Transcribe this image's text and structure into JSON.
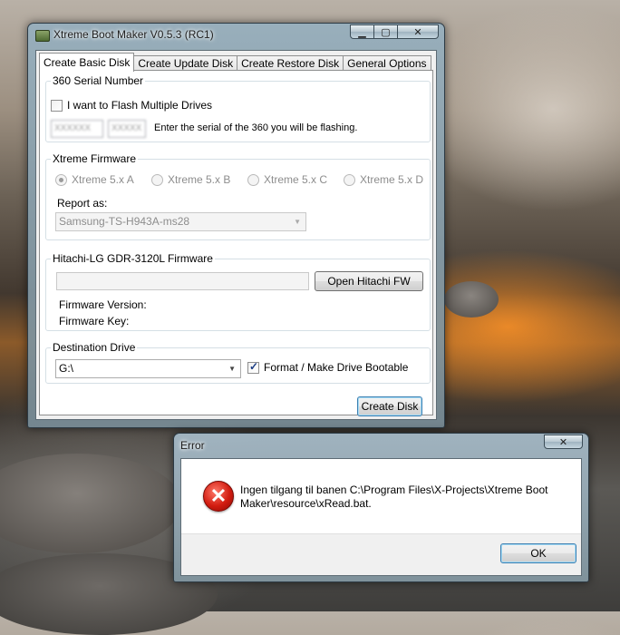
{
  "main_window": {
    "title": "Xtreme Boot Maker V0.5.3 (RC1)",
    "caption_icons": {
      "minimize": "minimize-icon",
      "maximize": "maximize-icon",
      "close": "close-icon"
    },
    "tabs": [
      {
        "label": "Create Basic Disk",
        "active": true
      },
      {
        "label": "Create Update Disk",
        "active": false
      },
      {
        "label": "Create Restore Disk",
        "active": false
      },
      {
        "label": "General Options",
        "active": false
      }
    ],
    "serial_group": {
      "legend": "360 Serial Number",
      "flash_multiple_label": "I want to Flash Multiple Drives",
      "flash_multiple_checked": false,
      "serial_part1": "XXXXXX",
      "serial_part2": "XXXXX",
      "hint": "Enter the serial of the 360 you will be flashing."
    },
    "firmware_group": {
      "legend": "Xtreme Firmware",
      "options": [
        {
          "label": "Xtreme 5.x A",
          "checked": true
        },
        {
          "label": "Xtreme 5.x B",
          "checked": false
        },
        {
          "label": "Xtreme 5.x C",
          "checked": false
        },
        {
          "label": "Xtreme 5.x D",
          "checked": false
        }
      ],
      "report_as_label": "Report as:",
      "report_as_value": "Samsung-TS-H943A-ms28"
    },
    "hitachi_group": {
      "legend": "Hitachi-LG GDR-3120L Firmware",
      "open_button": "Open Hitachi FW",
      "version_label": "Firmware Version:",
      "key_label": "Firmware Key:"
    },
    "destination_group": {
      "legend": "Destination Drive",
      "drive_value": "G:\\",
      "format_label": "Format / Make Drive Bootable",
      "format_checked": true
    },
    "create_button": "Create Disk"
  },
  "error_dialog": {
    "title": "Error",
    "icon": "error-icon",
    "message": "Ingen tilgang til banen C:\\Program Files\\X-Projects\\Xtreme Boot Maker\\resource\\xRead.bat.",
    "ok_button": "OK"
  }
}
